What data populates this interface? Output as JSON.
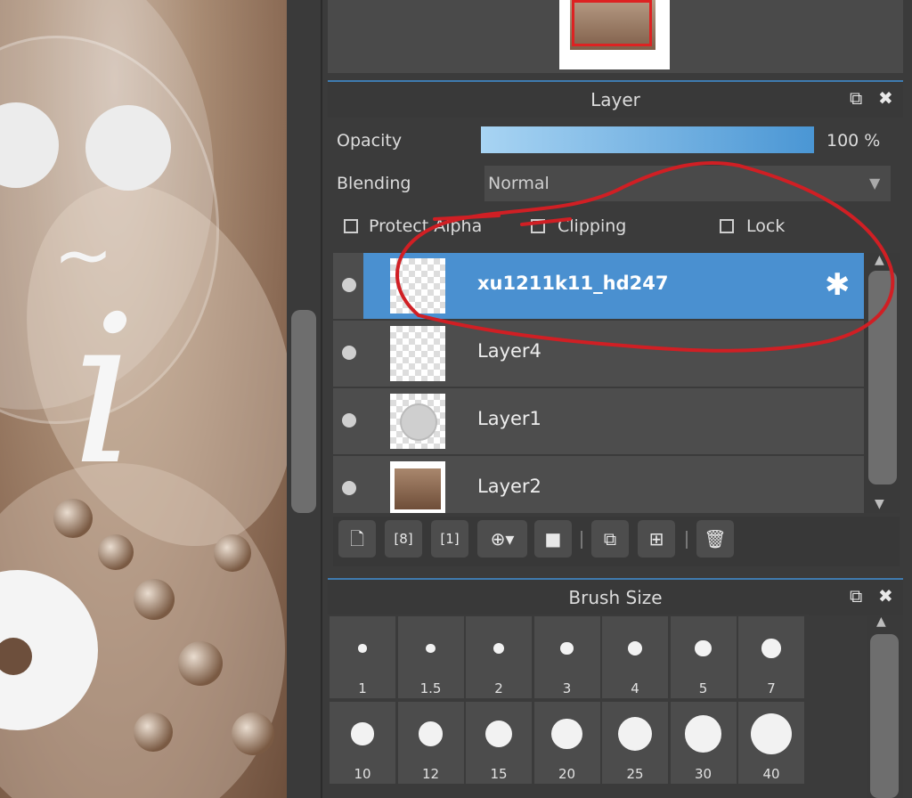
{
  "layer_panel": {
    "title": "Layer",
    "opacity_label": "Opacity",
    "opacity_value": "100 %",
    "opacity_fraction": 1.0,
    "blending_label": "Blending",
    "blending_value": "Normal",
    "checkboxes": {
      "protect_alpha": "Protect Alpha",
      "clipping": "Clipping",
      "lock": "Lock"
    },
    "layers": [
      {
        "name": "xu1211k11_hd247",
        "selected": true
      },
      {
        "name": "Layer4",
        "selected": false
      },
      {
        "name": "Layer1",
        "selected": false
      },
      {
        "name": "Layer2",
        "selected": false
      }
    ],
    "toolbar_icons": [
      "new-layer-icon",
      "new-8bit-layer-icon",
      "new-1bit-layer-icon",
      "add-layer-menu-icon",
      "folder-icon",
      "duplicate-icon",
      "merge-icon",
      "delete-icon"
    ]
  },
  "brush_panel": {
    "title": "Brush Size",
    "sizes": [
      "1",
      "1.5",
      "2",
      "3",
      "4",
      "5",
      "7",
      "10",
      "12",
      "15",
      "20",
      "25",
      "30",
      "40"
    ]
  },
  "colors": {
    "accent": "#4a90d0",
    "annotation": "#d01f24",
    "panel": "#3b3b3b"
  }
}
